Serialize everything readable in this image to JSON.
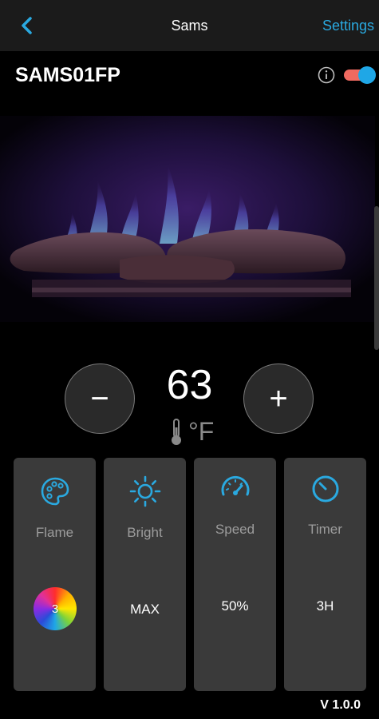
{
  "header": {
    "title": "Sams",
    "settings_label": "Settings"
  },
  "device": {
    "name": "SAMS01FP",
    "power_on": true
  },
  "temperature": {
    "value": "63",
    "unit": "°F",
    "decrease_label": "−",
    "increase_label": "+"
  },
  "controls": [
    {
      "label": "Flame",
      "value": "3",
      "icon": "palette-icon"
    },
    {
      "label": "Bright",
      "value": "MAX",
      "icon": "sun-icon"
    },
    {
      "label": "Speed",
      "value": "50%",
      "icon": "speedometer-icon"
    },
    {
      "label": "Timer",
      "value": "3H",
      "icon": "timer-icon"
    }
  ],
  "footer": {
    "version": "V 1.0.0"
  },
  "colors": {
    "accent": "#2aa9e0",
    "toggle_track": "#f06a60",
    "card_bg": "#3a3a3a",
    "topbar_bg": "#1b1b1b"
  }
}
